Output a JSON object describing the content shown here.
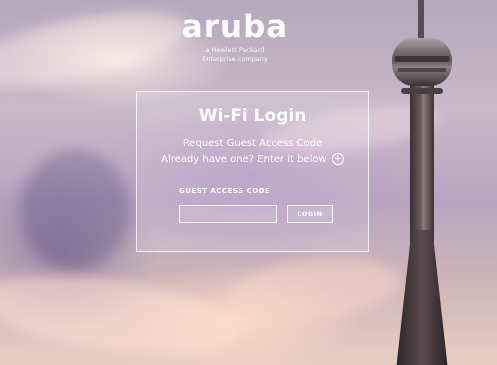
{
  "brand": {
    "logo_text": "aruba",
    "tagline_line1": "a Hewlett Packard",
    "tagline_line2": "Enterprise company"
  },
  "login": {
    "title": "Wi-Fi Login",
    "request_link": "Request Guest Access Code",
    "already_text": "Already have one? Enter it below",
    "code_label": "GUEST ACCESS CODE",
    "code_value": "",
    "button_label": "LOGIN"
  },
  "icons": {
    "expand": "plus-circle-icon"
  },
  "colors": {
    "text": "#ffffff",
    "panel_border": "#ffffff"
  }
}
